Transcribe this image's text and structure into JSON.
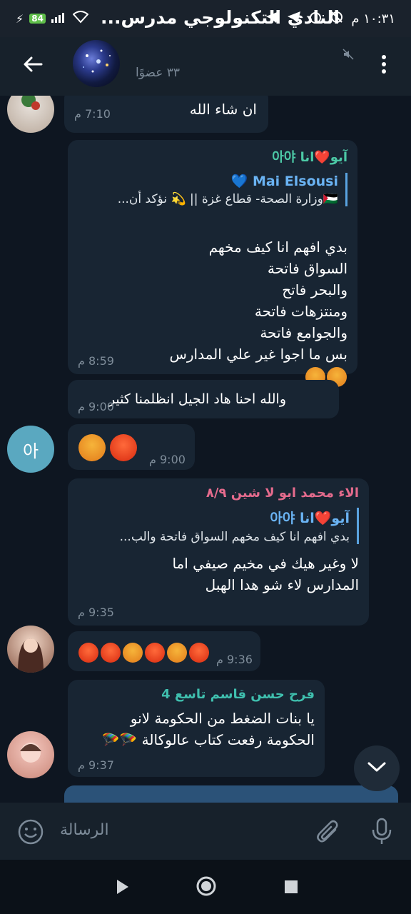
{
  "statusbar": {
    "battery": "84",
    "time": "١٠:٣١ م"
  },
  "header": {
    "title": "النادي التكنولوجي مدرس...",
    "members": "٣٣ عضوًا"
  },
  "messages": [
    {
      "text": "ان شاء الله",
      "time": "7:10 م"
    },
    {
      "sender": "آيو❤️انا 아야",
      "quote_name": "Mai Elsousi 💙",
      "quote_text": "🇵🇸وزارة الصحة- قطاع غزة || 💫 نؤكد أن...",
      "text": "بدي افهم انا كيف مخهم\nالسواق فاتحة\nوالبحر فاتح\nومنتزهات فاتحة\nوالجوامع فاتحة\nبس ما اجوا غير علي المدارس",
      "time": "8:59 م"
    },
    {
      "text": "والله احنا هاد الجيل انظلمنا كثير",
      "time": "9:00 م"
    },
    {
      "text": "",
      "time": "9:00 م",
      "avatar": "아"
    },
    {
      "sender": "الاء محمد ابو لا شين ٨/٩",
      "quote_name": "آيو❤️انا 아야",
      "quote_text": "بدي افهم انا كيف مخهم  السواق فاتحة  والب...",
      "text": "لا وغير هيك في مخيم صيفي اما\nالمدارس لاء شو هدا الهبل",
      "time": "9:35 م"
    },
    {
      "text": "",
      "time": "9:36 م"
    },
    {
      "sender": "فرح حسن قاسم تاسع 4",
      "text": "يا بنات الضغط من الحكومة لانو\nالحكومة رفعت كتاب عالوكالة 🪂🪂",
      "time": "9:37 م"
    }
  ],
  "input": {
    "placeholder": "الرسالة"
  },
  "icons": [
    "back-arrow-icon",
    "mute-icon",
    "more-vert-icon",
    "emoji-icon",
    "attach-icon",
    "mic-icon",
    "chevron-down-icon",
    "nav-back-icon",
    "nav-home-icon",
    "nav-recents-icon"
  ],
  "colors": {
    "background": "#0e1621",
    "bubble": "#182533",
    "accent": "#6ab3f3",
    "sender_green": "#4cc9a6",
    "sender_pink": "#e56b8d",
    "sender_teal": "#3fbfae"
  }
}
